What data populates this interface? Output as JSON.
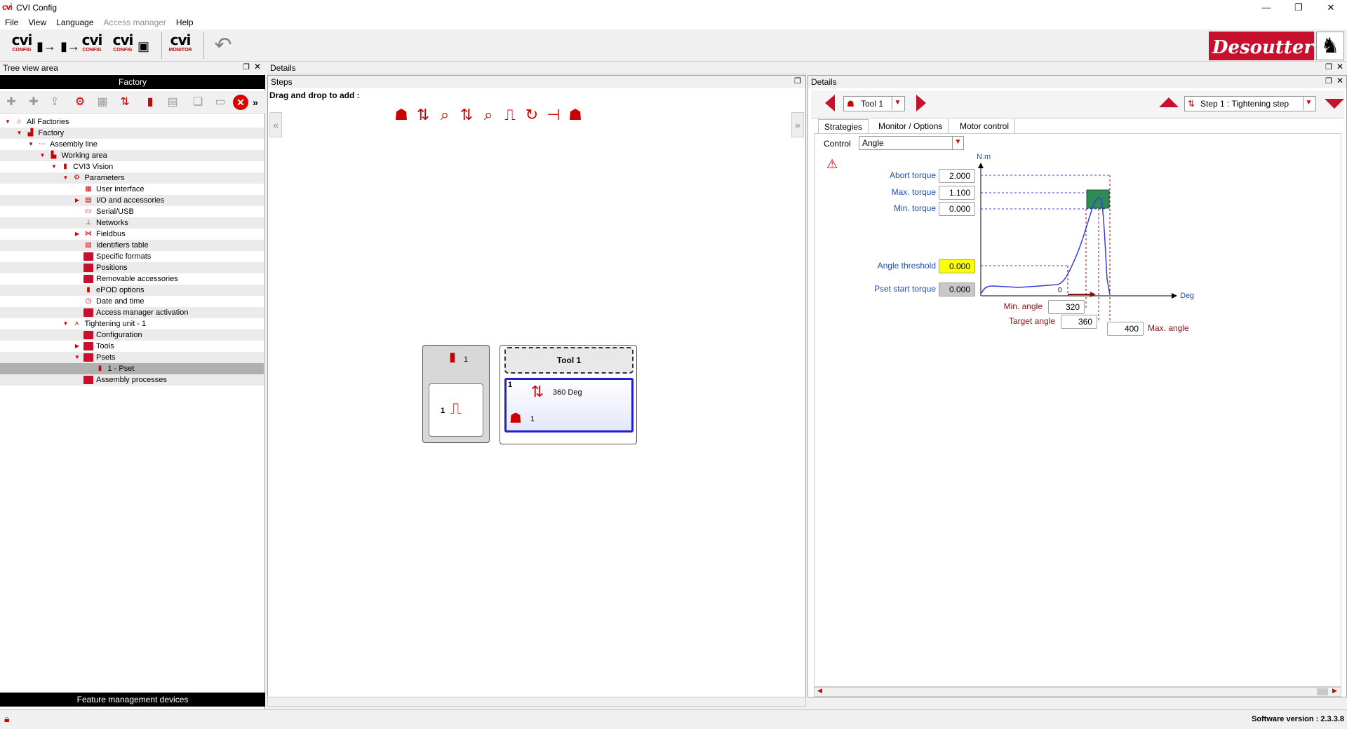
{
  "window": {
    "logo_text": "cvi",
    "title": "CVI Config",
    "minimize_glyph": "—",
    "restore_glyph": "❐",
    "close_glyph": "✕"
  },
  "menu": [
    {
      "label": "File",
      "enabled": true
    },
    {
      "label": "View",
      "enabled": true
    },
    {
      "label": "Language",
      "enabled": true
    },
    {
      "label": "Access manager",
      "enabled": false
    },
    {
      "label": "Help",
      "enabled": true
    }
  ],
  "toolbar": {
    "buttons": [
      {
        "name": "cvi-config-export-button",
        "text": "cvi",
        "sub": "CONFIG"
      },
      {
        "name": "cvi-config-import-button",
        "text": "cvi",
        "sub": "CONFIG"
      },
      {
        "name": "cvi-config-search-button",
        "text": "cvi",
        "sub": "CONFIG"
      },
      {
        "name": "cvi-monitor-button",
        "text": "cvi",
        "sub": "MONITOR"
      }
    ],
    "undo_icon": "undo-icon",
    "brand": "Desoutter",
    "brand_logo_icon": "horse-head-icon"
  },
  "left": {
    "title": "Tree view area",
    "root_header": "Factory",
    "tree": [
      {
        "label": "All Factories",
        "level": 0,
        "expanded": true,
        "icon": "home-icon"
      },
      {
        "label": "Factory",
        "level": 1,
        "expanded": true,
        "icon": "factory-icon"
      },
      {
        "label": "Assembly line",
        "level": 2,
        "expanded": true,
        "icon": "assembly-line-icon"
      },
      {
        "label": "Working area",
        "level": 3,
        "expanded": true,
        "icon": "working-area-icon"
      },
      {
        "label": "CVI3 Vision",
        "level": 4,
        "expanded": true,
        "icon": "controller-icon"
      },
      {
        "label": "Parameters",
        "level": 5,
        "expanded": true,
        "icon": "parameters-icon"
      },
      {
        "label": "User interface",
        "level": 6,
        "expanded": null,
        "icon": "user-interface-icon"
      },
      {
        "label": "I/O and accessories",
        "level": 6,
        "expanded": false,
        "icon": "io-icon"
      },
      {
        "label": "Serial/USB",
        "level": 6,
        "expanded": null,
        "icon": "serial-usb-icon"
      },
      {
        "label": "Networks",
        "level": 6,
        "expanded": null,
        "icon": "network-icon"
      },
      {
        "label": "Fieldbus",
        "level": 6,
        "expanded": false,
        "icon": "fieldbus-icon"
      },
      {
        "label": "Identifiers table",
        "level": 6,
        "expanded": null,
        "icon": "identifiers-icon"
      },
      {
        "label": "Specific formats",
        "level": 6,
        "expanded": null,
        "icon": "folder-icon"
      },
      {
        "label": "Positions",
        "level": 6,
        "expanded": null,
        "icon": "folder-icon"
      },
      {
        "label": "Removable accessories",
        "level": 6,
        "expanded": null,
        "icon": "folder-icon"
      },
      {
        "label": "ePOD options",
        "level": 6,
        "expanded": null,
        "icon": "epod-icon"
      },
      {
        "label": "Date and time",
        "level": 6,
        "expanded": null,
        "icon": "clock-icon"
      },
      {
        "label": "Access manager activation",
        "level": 6,
        "expanded": null,
        "icon": "folder-icon"
      },
      {
        "label": "Tightening unit - 1",
        "level": 5,
        "expanded": true,
        "icon": "tightening-unit-icon"
      },
      {
        "label": "Configuration",
        "level": 6,
        "expanded": null,
        "icon": "folder-icon"
      },
      {
        "label": "Tools",
        "level": 6,
        "expanded": false,
        "icon": "folder-icon"
      },
      {
        "label": "Psets",
        "level": 6,
        "expanded": true,
        "icon": "folder-icon"
      },
      {
        "label": "1 - Pset",
        "level": 7,
        "expanded": null,
        "icon": "screw-icon",
        "selected": true
      },
      {
        "label": "Assembly processes",
        "level": 6,
        "expanded": null,
        "icon": "folder-icon"
      }
    ],
    "footer": "Feature management devices"
  },
  "center": {
    "title": "Details",
    "steps_title": "Steps",
    "drag_label": "Drag and drop to add :",
    "step_icons": [
      "tool-stop-icon",
      "run-down-icon",
      "inspection-icon",
      "tightening-icon",
      "search-icon",
      "stair-icon",
      "loosening-icon",
      "jump-icon",
      "tool-release-icon"
    ],
    "pset_block": {
      "screw_count": "1",
      "step_number": "1"
    },
    "tool_block": {
      "title": "Tool 1",
      "step_number": "1",
      "step_label": "360 Deg",
      "sub_count": "1"
    }
  },
  "right": {
    "title": "Details",
    "tool_selector": "Tool 1",
    "step_selector": "Step 1 : Tightening step",
    "tabs": [
      "Strategies",
      "Monitor / Options",
      "Motor control"
    ],
    "control_label": "Control",
    "control_value": "Angle",
    "y_unit": "N.m",
    "x_unit": "Deg",
    "origin_label": "0",
    "fields": {
      "abort_torque": {
        "label": "Abort torque",
        "value": "2.000"
      },
      "max_torque": {
        "label": "Max. torque",
        "value": "1.100"
      },
      "min_torque": {
        "label": "Min. torque",
        "value": "0.000"
      },
      "angle_threshold": {
        "label": "Angle threshold",
        "value": "0.000"
      },
      "pset_start_torque": {
        "label": "Pset start torque",
        "value": "0.000"
      },
      "min_angle": {
        "label": "Min. angle",
        "value": "320"
      },
      "target_angle": {
        "label": "Target angle",
        "value": "360"
      },
      "max_angle": {
        "label": "Max. angle",
        "value": "400"
      }
    },
    "colors": {
      "blue_label": "#1f4fb0",
      "red_label": "#8b1010",
      "target_box": "#2e8b57",
      "curve": "#3a3ad8",
      "highlight": "#ffff00"
    }
  },
  "status": {
    "software_version": "Software version : 2.3.3.8"
  }
}
